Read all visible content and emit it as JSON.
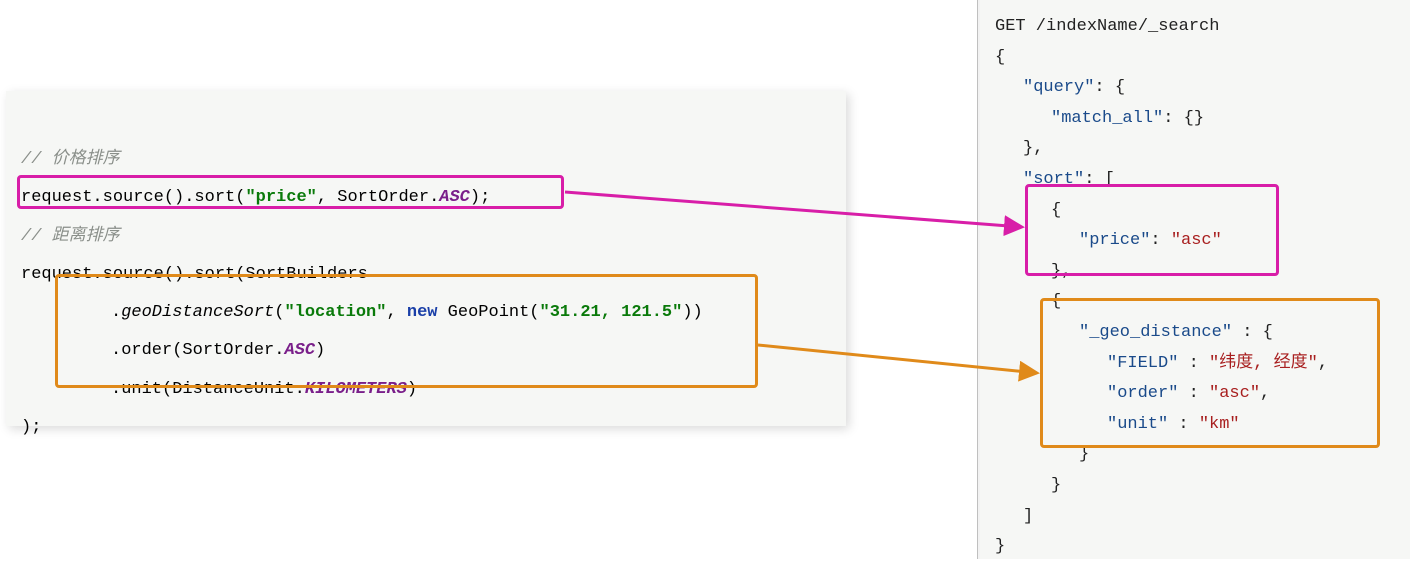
{
  "left": {
    "comment1_prefix": "//",
    "comment1_text": "价格排序",
    "line1_a": "request.source().sort(",
    "line1_str": "\"price\"",
    "line1_b": ", SortOrder.",
    "line1_asc": "ASC",
    "line1_c": ");",
    "comment2_prefix": "//",
    "comment2_text": "距离排序",
    "line2": "request.source().sort(SortBuilders",
    "line3_a": ".",
    "line3_method": "geoDistanceSort",
    "line3_b": "(",
    "line3_loc": "\"location\"",
    "line3_c": ", ",
    "line3_new": "new",
    "line3_d": " GeoPoint(",
    "line3_coords": "\"31.21, 121.5\"",
    "line3_e": "))",
    "line4_a": ".order(SortOrder.",
    "line4_asc": "ASC",
    "line4_b": ")",
    "line5_a": ".unit(DistanceUnit.",
    "line5_km": "KILOMETERS",
    "line5_b": ")",
    "line6": ");"
  },
  "right": {
    "r1": "GET /indexName/_search",
    "r2": "{",
    "r3_k": "\"query\"",
    "r3_v": ": {",
    "r4_k": "\"match_all\"",
    "r4_v": ": {}",
    "r5": "},",
    "r6_k": "\"sort\"",
    "r6_v": ": [",
    "r7": "{",
    "r8_k": "\"price\"",
    "r8_c": ": ",
    "r8_v": "\"asc\"",
    "r9": "},",
    "r10": "{",
    "r11_k": "\"_geo_distance\"",
    "r11_v": " : {",
    "r12_k": "\"FIELD\"",
    "r12_c": " : ",
    "r12_v": "\"纬度, 经度\"",
    "r12_t": ",",
    "r13_k": "\"order\"",
    "r13_c": " : ",
    "r13_v": "\"asc\"",
    "r13_t": ",",
    "r14_k": "\"unit\"",
    "r14_c": " : ",
    "r14_v": "\"km\"",
    "r15": "}",
    "r16": "}",
    "r17": "]",
    "r18": "}"
  }
}
